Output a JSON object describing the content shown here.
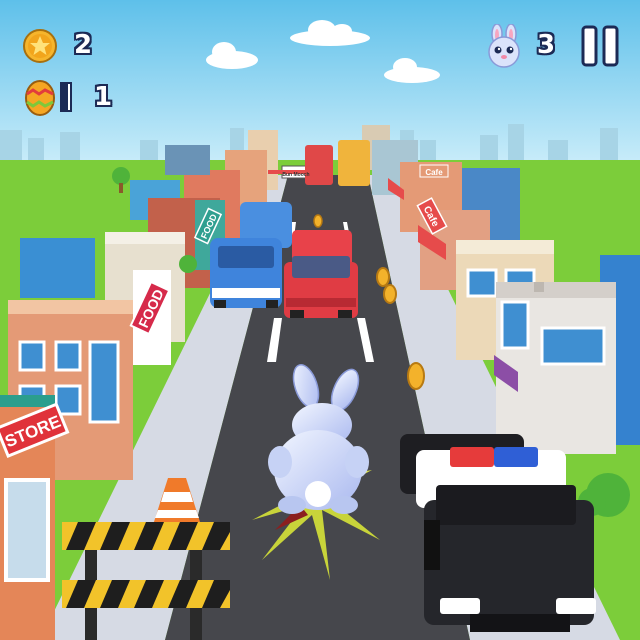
{
  "hud": {
    "coins": "2",
    "eggs": "1",
    "lives": "3",
    "icons": {
      "coin": "star-coin-icon",
      "egg": "easter-egg-icon",
      "lives": "bunny-face-icon",
      "pause": "pause-icon"
    }
  },
  "signs": {
    "store": "STORE",
    "food": "FOOD",
    "food_far": "FOOD",
    "cafe": "Cafe",
    "cafe_far": "Cafe",
    "banner": "Bun Mooch"
  },
  "colors": {
    "sky_top": "#6cc6ea",
    "grass": "#7ed03a",
    "road": "#47484d",
    "sidewalk": "#d9dde6",
    "coin": "#f3b22b",
    "police_light_red": "#e63b3b",
    "police_light_blue": "#2f5fd6"
  }
}
